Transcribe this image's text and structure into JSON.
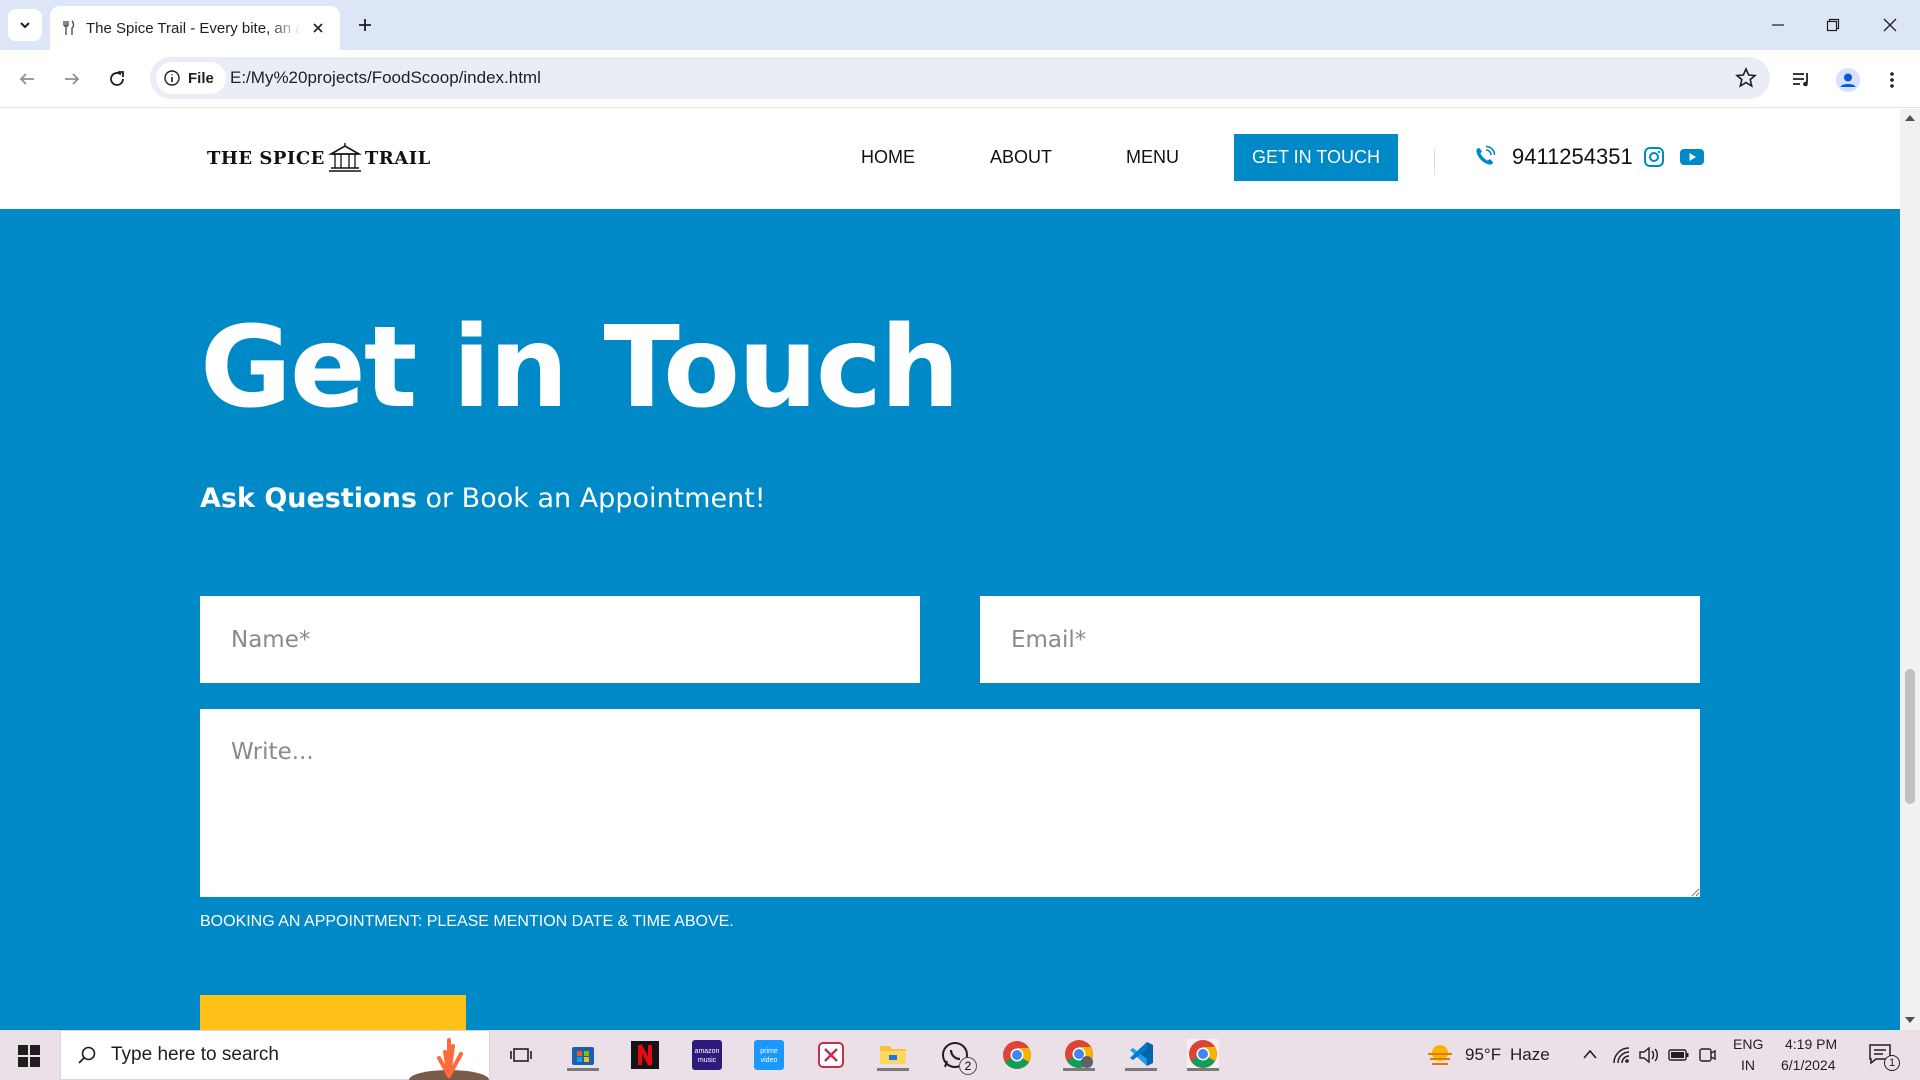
{
  "browser": {
    "tab_title": "The Spice Trail - Every bite, an adventure",
    "site_info_label": "File",
    "url": "E:/My%20projects/FoodScoop/index.html"
  },
  "site": {
    "logo_left": "THE SPICE",
    "logo_right": "TRAIL",
    "nav": {
      "home": "HOME",
      "about": "ABOUT",
      "menu": "MENU",
      "cta": "GET IN TOUCH"
    },
    "phone": "9411254351"
  },
  "contact": {
    "title": "Get in Touch",
    "subtitle_bold": "Ask Questions",
    "subtitle_rest": "or Book an Appointment!",
    "name_placeholder": "Name*",
    "email_placeholder": "Email*",
    "message_placeholder": "Write...",
    "note": "BOOKING AN APPOINTMENT: PLEASE MENTION DATE & TIME ABOVE."
  },
  "taskbar": {
    "search_placeholder": "Type here to search",
    "whatsapp_badge": "2",
    "weather_temp": "95°F",
    "weather_desc": "Haze",
    "lang_line1": "ENG",
    "lang_line2": "IN",
    "time": "4:19 PM",
    "date": "6/1/2024",
    "notification_count": "1"
  },
  "colors": {
    "brand_blue": "#0089c7",
    "submit_yellow": "#fdc117",
    "tabstrip": "#dce6f7",
    "taskbar": "#ece0e8"
  }
}
